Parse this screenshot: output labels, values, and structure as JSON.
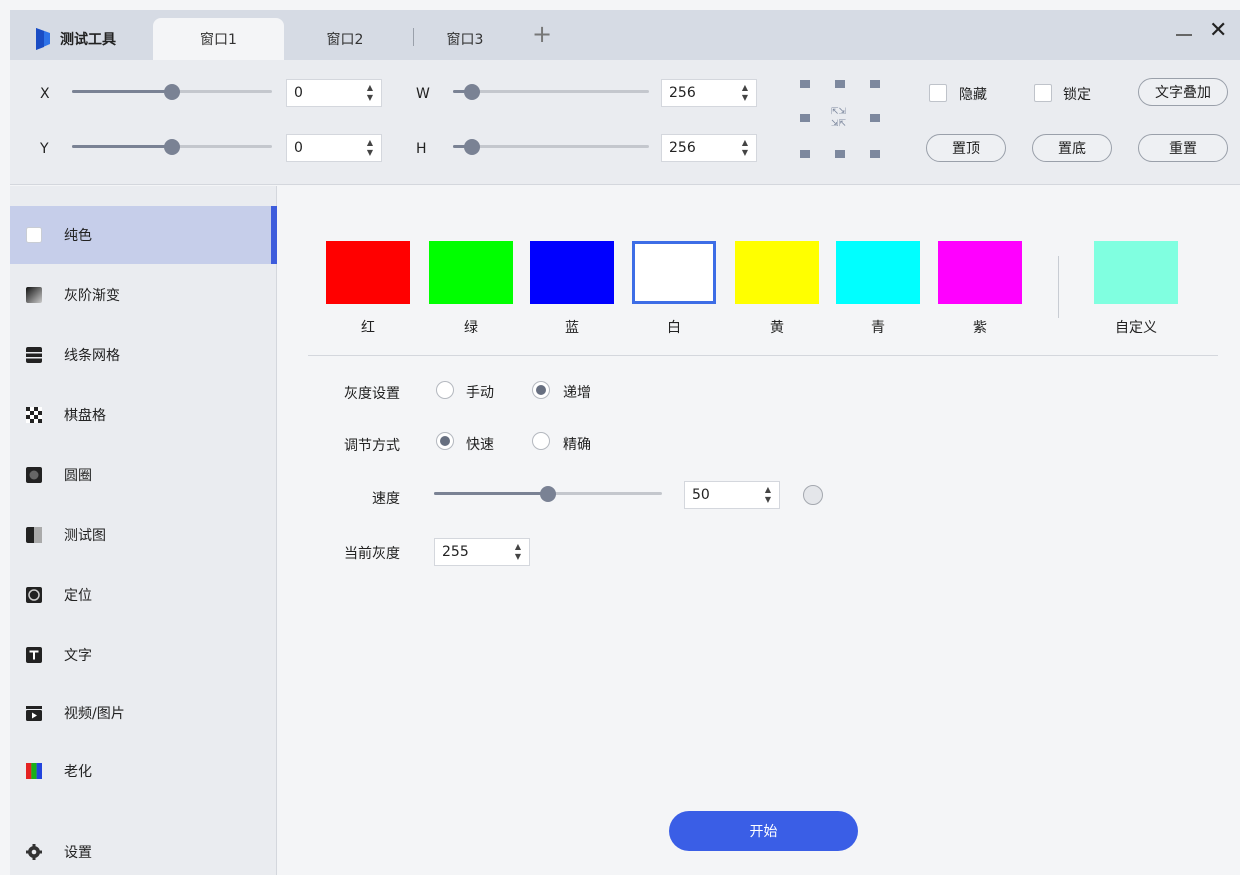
{
  "app": {
    "title": "测试工具"
  },
  "tabs": [
    {
      "label": "窗口1",
      "active": true
    },
    {
      "label": "窗口2",
      "active": false
    },
    {
      "label": "窗口3",
      "active": false
    }
  ],
  "tab_add_label": "+",
  "window_controls": {
    "minimize": "—",
    "close": "✕"
  },
  "toolbar": {
    "x": {
      "label": "X",
      "value": "0",
      "slider_fraction": 0.5
    },
    "y": {
      "label": "Y",
      "value": "0",
      "slider_fraction": 0.5
    },
    "w": {
      "label": "W",
      "value": "256",
      "slider_fraction": 0.06
    },
    "h": {
      "label": "H",
      "value": "256",
      "slider_fraction": 0.06
    },
    "hide": {
      "label": "隐藏",
      "checked": false
    },
    "lock": {
      "label": "锁定",
      "checked": false
    },
    "text_overlay": "文字叠加",
    "bring_top": "置顶",
    "send_bottom": "置底",
    "reset": "重置"
  },
  "sidebar": {
    "items": [
      {
        "label": "纯色",
        "icon": "square-icon",
        "active": true
      },
      {
        "label": "灰阶渐变",
        "icon": "gradient-icon",
        "active": false
      },
      {
        "label": "线条网格",
        "icon": "lines-grid-icon",
        "active": false
      },
      {
        "label": "棋盘格",
        "icon": "checkerboard-icon",
        "active": false
      },
      {
        "label": "圆圈",
        "icon": "circle-icon",
        "active": false
      },
      {
        "label": "测试图",
        "icon": "test-pattern-icon",
        "active": false
      },
      {
        "label": "定位",
        "icon": "target-icon",
        "active": false
      },
      {
        "label": "文字",
        "icon": "text-icon",
        "active": false
      },
      {
        "label": "视频/图片",
        "icon": "video-icon",
        "active": false
      },
      {
        "label": "老化",
        "icon": "aging-bars-icon",
        "active": false
      }
    ],
    "settings": {
      "label": "设置",
      "icon": "gear-icon"
    }
  },
  "colors": [
    {
      "label": "红",
      "hex": "#ff0000",
      "selected": false
    },
    {
      "label": "绿",
      "hex": "#00ff00",
      "selected": false
    },
    {
      "label": "蓝",
      "hex": "#0000ff",
      "selected": false
    },
    {
      "label": "白",
      "hex": "#ffffff",
      "selected": true
    },
    {
      "label": "黄",
      "hex": "#ffff00",
      "selected": false
    },
    {
      "label": "青",
      "hex": "#00ffff",
      "selected": false
    },
    {
      "label": "紫",
      "hex": "#ff00ff",
      "selected": false
    }
  ],
  "custom_color": {
    "label": "自定义",
    "hex": "#80ffe0"
  },
  "settings_panel": {
    "gray_setting": {
      "label": "灰度设置",
      "options": [
        "手动",
        "递增"
      ],
      "selected": 1
    },
    "adjust_mode": {
      "label": "调节方式",
      "options": [
        "快速",
        "精确"
      ],
      "selected": 0
    },
    "speed": {
      "label": "速度",
      "value": "50",
      "slider_fraction": 0.5
    },
    "current_gray": {
      "label": "当前灰度",
      "value": "255"
    }
  },
  "start_button": "开始",
  "accent_color": "#3a5ee6"
}
